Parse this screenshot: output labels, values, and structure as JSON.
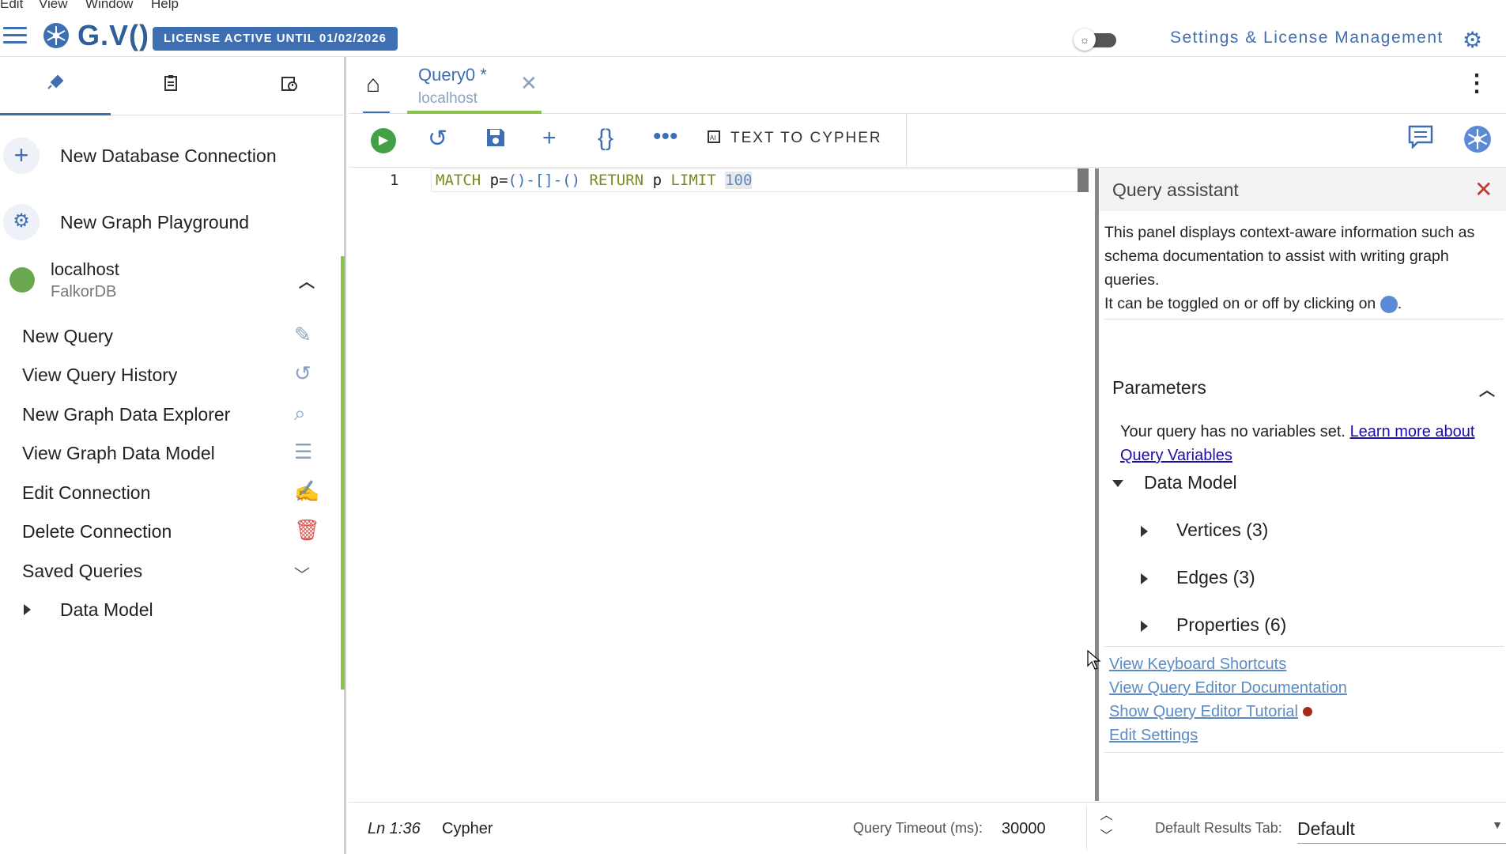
{
  "menu": [
    "Edit",
    "View",
    "Window",
    "Help"
  ],
  "app": {
    "logo_text": "G.V()",
    "license_badge": "LICENSE ACTIVE UNTIL 01/02/2026",
    "settings_link": "Settings & License Management",
    "theme_toggle_icon": "sun-icon"
  },
  "sidebar": {
    "tabs": [
      "connections-icon",
      "clipboard-icon",
      "history-icon"
    ],
    "actions": [
      {
        "label": "New Database Connection",
        "icon": "plus-icon"
      },
      {
        "label": "New Graph Playground",
        "icon": "chip-icon"
      }
    ],
    "connection": {
      "name": "localhost",
      "type": "FalkorDB",
      "status_color": "#6aa84f"
    },
    "items": [
      {
        "label": "New Query",
        "icon": "magic-pen-icon"
      },
      {
        "label": "View Query History",
        "icon": "history-icon"
      },
      {
        "label": "New Graph Data Explorer",
        "icon": "explore-icon"
      },
      {
        "label": "View Graph Data Model",
        "icon": "database-icon"
      },
      {
        "label": "Edit Connection",
        "icon": "edit-icon"
      },
      {
        "label": "Delete Connection",
        "icon": "trash-icon"
      },
      {
        "label": "Saved Queries",
        "icon": "chevron-down-icon"
      }
    ],
    "data_model_label": "Data Model"
  },
  "tab": {
    "title": "Query0 *",
    "subtitle": "localhost"
  },
  "toolbar": {
    "text_to_cypher": "TEXT TO CYPHER"
  },
  "editor": {
    "line_number": "1",
    "code": {
      "kw1": "MATCH",
      "p1": " p=",
      "pat": "()-[]-()",
      "kw2": " RETURN",
      "p2": " p ",
      "kw3": "LIMIT",
      "num": "100"
    }
  },
  "assistant": {
    "title": "Query assistant",
    "desc1": "This panel displays context-aware information such as schema documentation to assist with writing graph queries.",
    "desc2_a": "It can be toggled on or off by clicking on",
    "desc2_b": ".",
    "params_title": "Parameters",
    "params_text": "Your query has no variables set.",
    "params_link": "Learn more about Query Variables",
    "data_model": "Data Model",
    "vertices": "Vertices (3)",
    "edges": "Edges (3)",
    "properties": "Properties (6)",
    "links": [
      "View Keyboard Shortcuts",
      "View Query Editor Documentation",
      "Show Query Editor Tutorial",
      "Edit Settings"
    ]
  },
  "status": {
    "position": "Ln 1:36",
    "language": "Cypher",
    "timeout_label": "Query Timeout (ms):",
    "timeout_value": "30000",
    "results_label": "Default Results Tab:",
    "results_value": "Default"
  },
  "colors": {
    "accent": "#3f6fb3",
    "run": "#43a047",
    "tab_underline": "#8bc34a",
    "danger": "#d9534f"
  }
}
